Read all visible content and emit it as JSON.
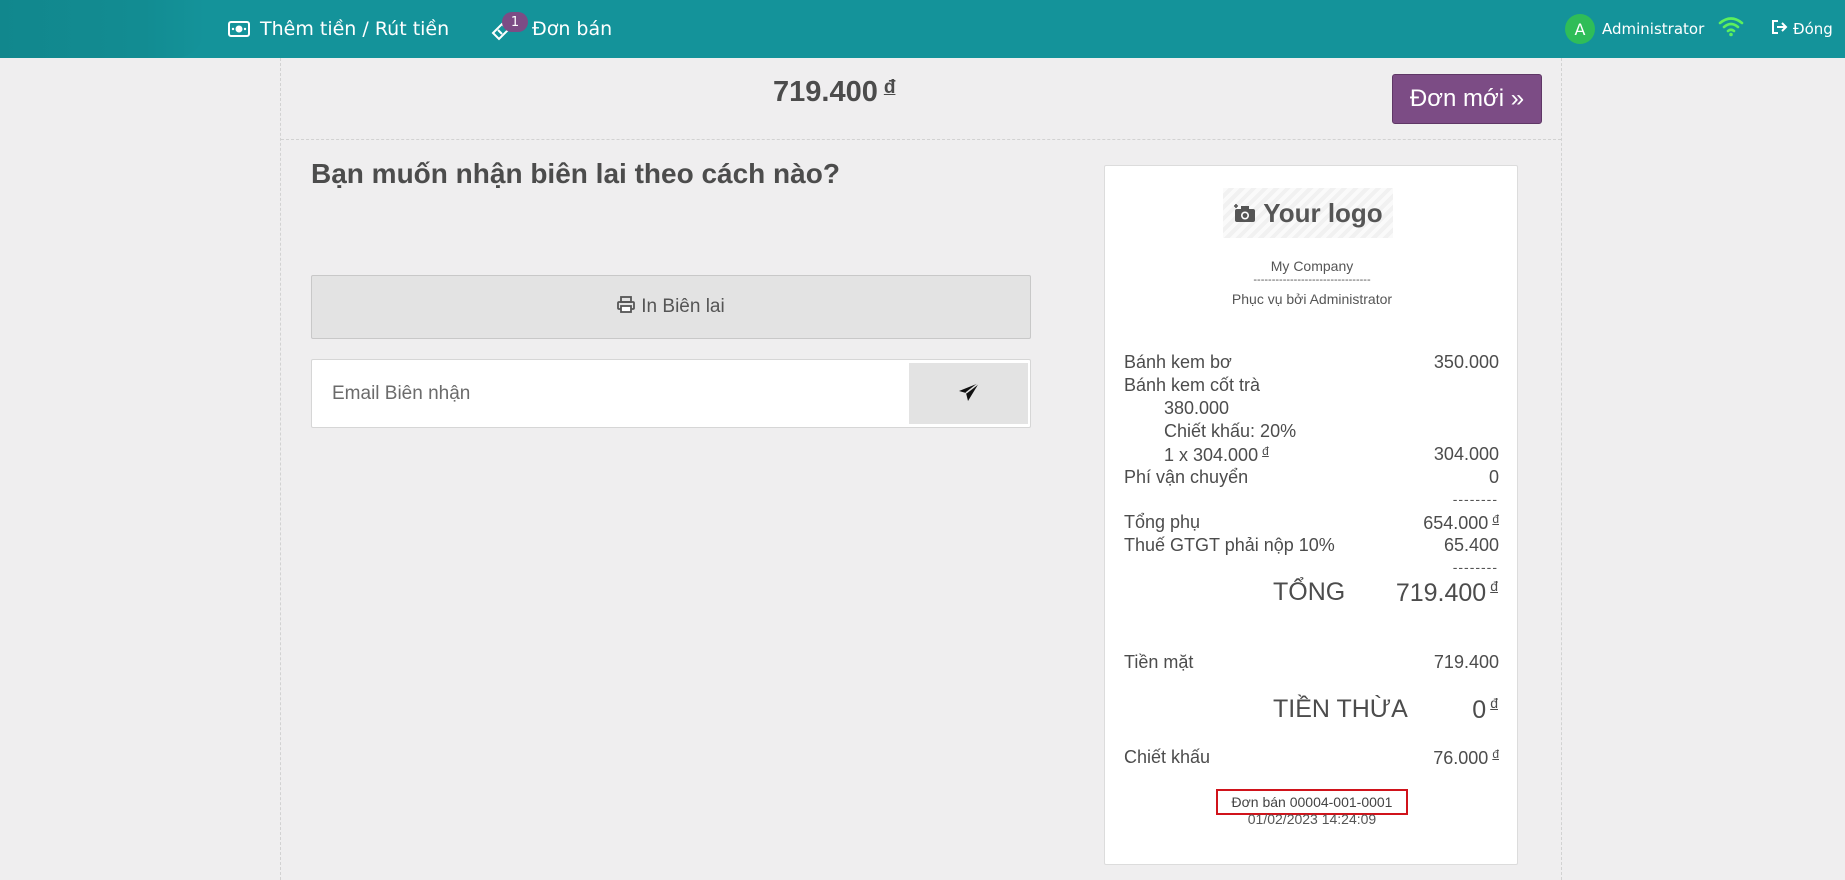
{
  "header": {
    "cash_label": "Thêm tiền / Rút tiền",
    "orders_badge": "1",
    "orders_label": "Đơn bán",
    "user_initial": "A",
    "user_name": "Administrator",
    "close_label": "Đóng",
    "bar_color": "#14939a"
  },
  "payment": {
    "total_amount": "719.400",
    "currency": "đ",
    "new_order_label": "Đơn mới »",
    "question": "Bạn muốn nhận biên lai theo cách nào?",
    "print_label": "In Biên lai",
    "email_placeholder": "Email Biên nhận",
    "accent_color": "#7c4c85"
  },
  "receipt": {
    "logo_text": "Your logo",
    "company": "My Company",
    "separator": "--------------------------------",
    "served_by": "Phục vụ bởi Administrator",
    "lines": [
      {
        "name": "Bánh kem bơ",
        "price": "350.000"
      },
      {
        "name": "Bánh kem cốt trà",
        "unit_price": "380.000",
        "discount": "Chiết khấu: 20%",
        "qty_line": "1 x 304.000",
        "price": "304.000"
      },
      {
        "name": "Phí vận chuyển",
        "price": "0"
      }
    ],
    "dashes": "--------",
    "subtotal_label": "Tổng phụ",
    "subtotal_value": "654.000",
    "tax_label": "Thuế GTGT phải nộp 10%",
    "tax_value": "65.400",
    "total_label": "TỔNG",
    "total_value": "719.400",
    "cash_label": "Tiền mặt",
    "cash_value": "719.400",
    "change_label": "TIỀN THỪA",
    "change_value": "0",
    "discount_label": "Chiết khấu",
    "discount_value": "76.000",
    "currency": "đ",
    "order_ref": "Đơn bán 00004-001-0001",
    "datetime": "01/02/2023 14:24:09"
  }
}
